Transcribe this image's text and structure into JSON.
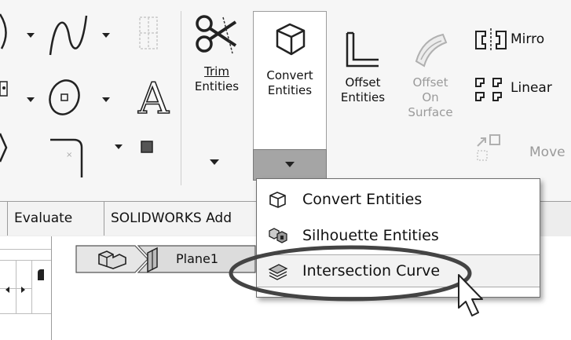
{
  "ribbon": {
    "trim_entities": {
      "label_line1": "Trim",
      "label_line2": "Entities"
    },
    "convert_entities": {
      "label_line1": "Convert",
      "label_line2": "Entities"
    },
    "offset_entities": {
      "label_line1": "Offset",
      "label_line2": "Entities"
    },
    "offset_on_surface": {
      "label_line1": "Offset",
      "label_line2": "On",
      "label_line3": "Surface"
    },
    "mirror": {
      "label": "Mirro"
    },
    "linear_pattern": {
      "label": "Linear"
    },
    "move": {
      "label": "Move"
    },
    "text_glyph": "A"
  },
  "tabs": [
    {
      "label": "Evaluate"
    },
    {
      "label": "SOLIDWORKS Add"
    }
  ],
  "breadcrumb": {
    "plane_label": "Plane1"
  },
  "dropdown": {
    "items": [
      {
        "label": "Convert Entities",
        "icon": "convert-entities-icon"
      },
      {
        "label": "Silhouette Entities",
        "icon": "silhouette-entities-icon"
      },
      {
        "label": "Intersection Curve",
        "icon": "intersection-curve-icon",
        "highlighted": true
      }
    ]
  },
  "annotation": {
    "color": "#444444"
  }
}
